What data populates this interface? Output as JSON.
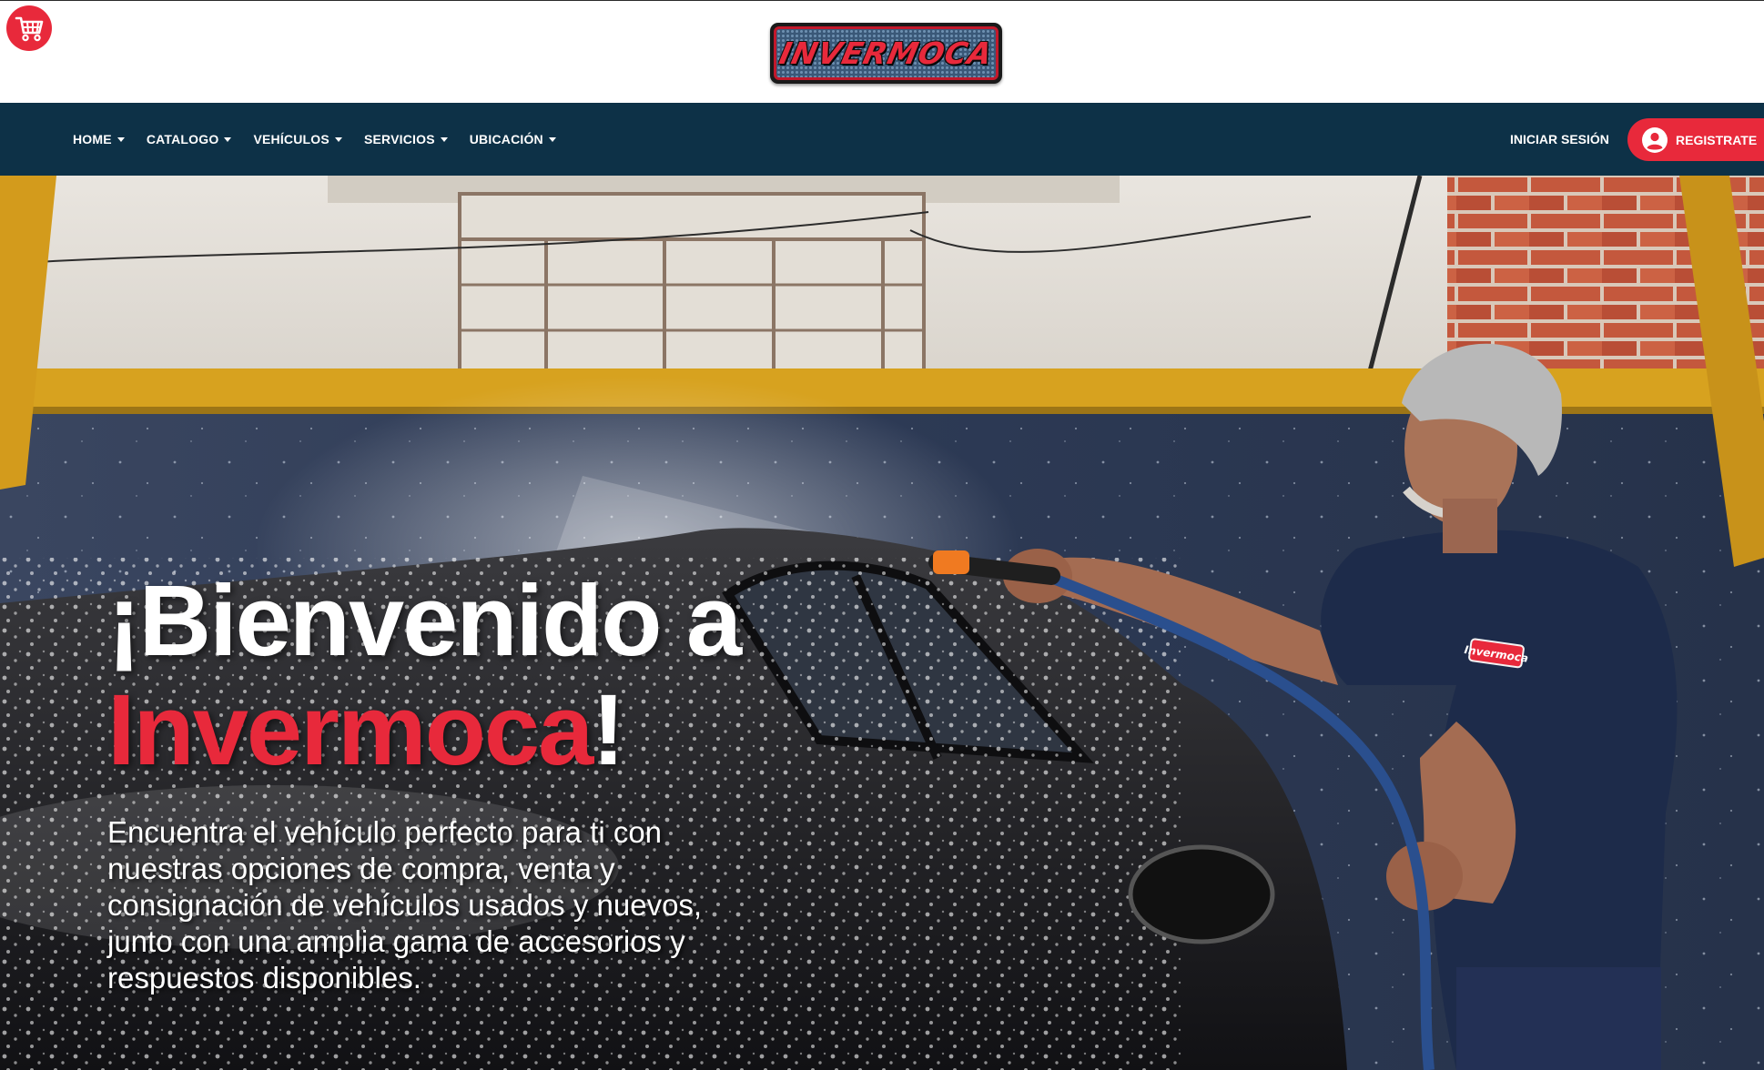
{
  "header": {
    "logo_text": "INVERMOCA",
    "cart_icon": "shopping-basket-icon",
    "colors": {
      "brand_red": "#e8293b",
      "navbar_bg": "#0d3147"
    }
  },
  "nav": {
    "items": [
      {
        "label": "HOME"
      },
      {
        "label": "CATALOGO"
      },
      {
        "label": "VEHÍCULOS"
      },
      {
        "label": "SERVICIOS"
      },
      {
        "label": "UBICACIÓN"
      }
    ],
    "login_label": "INICIAR SESIÓN",
    "register_label": "REGISTRATE",
    "register_icon": "user-circle-icon"
  },
  "hero": {
    "title_line1": "¡Bienvenido a",
    "title_brand": "Invermoca",
    "title_end": "!",
    "description": "Encuentra el vehículo perfecto para ti con nuestras opciones de compra, venta y consignación de vehículos usados y nuevos, junto con una amplia gama de accesorios y respuestos disponibles.",
    "shirt_logo": "Invermoca"
  }
}
